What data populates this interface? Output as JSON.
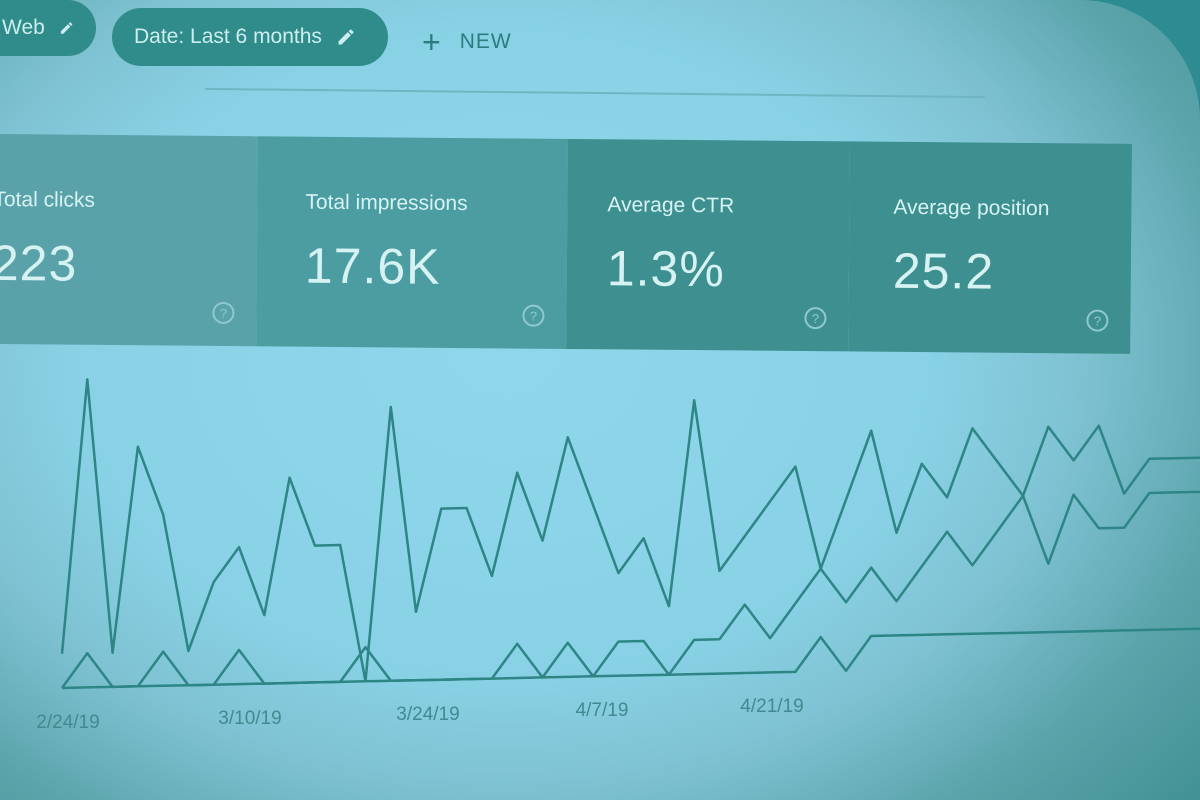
{
  "filters": {
    "web_chip": "Web",
    "date_chip": "Date: Last 6 months",
    "new_button": "NEW"
  },
  "metrics": [
    {
      "label": "Total clicks",
      "value": "223"
    },
    {
      "label": "Total impressions",
      "value": "17.6K"
    },
    {
      "label": "Average CTR",
      "value": "1.3%"
    },
    {
      "label": "Average position",
      "value": "25.2"
    }
  ],
  "colors": {
    "line": "#2e8585",
    "chip": "#2f8c8a",
    "card_dark": "#3d8f90"
  },
  "icons": {
    "edit": "pencil-icon",
    "add": "plus-icon",
    "help": "help-circle-icon"
  },
  "chart_data": {
    "type": "line",
    "x_tick_labels": [
      "2/24/19",
      "3/10/19",
      "3/24/19",
      "4/7/19",
      "4/21/19"
    ],
    "series": [
      {
        "values": [
          1,
          9,
          1,
          7,
          5,
          1,
          3,
          4,
          2,
          6,
          4,
          4,
          0,
          8,
          2,
          5,
          5,
          3,
          6,
          4,
          7,
          5,
          3,
          4,
          2,
          8,
          3,
          4,
          5,
          6,
          3,
          5,
          7,
          4,
          6,
          5,
          7,
          6,
          5,
          7,
          6,
          7,
          5,
          6,
          6,
          6
        ]
      },
      {
        "values": [
          0,
          1,
          0,
          0,
          1,
          0,
          0,
          1,
          0,
          0,
          0,
          0,
          1,
          0,
          0,
          0,
          0,
          0,
          1,
          0,
          1,
          0,
          1,
          1,
          0,
          1,
          1,
          2,
          1,
          2,
          3,
          2,
          3,
          2,
          3,
          4,
          3,
          4,
          5,
          3,
          5,
          4,
          4,
          5,
          5,
          5
        ]
      },
      {
        "values": [
          0,
          0,
          0,
          0,
          0,
          0,
          0,
          0,
          0,
          0,
          0,
          0,
          0,
          0,
          0,
          0,
          0,
          0,
          0,
          0,
          0,
          0,
          0,
          0,
          0,
          0,
          0,
          0,
          0,
          0,
          1,
          0,
          1,
          1,
          1,
          1,
          1,
          1,
          1,
          1,
          1,
          1,
          1,
          1,
          1,
          1
        ]
      }
    ]
  }
}
